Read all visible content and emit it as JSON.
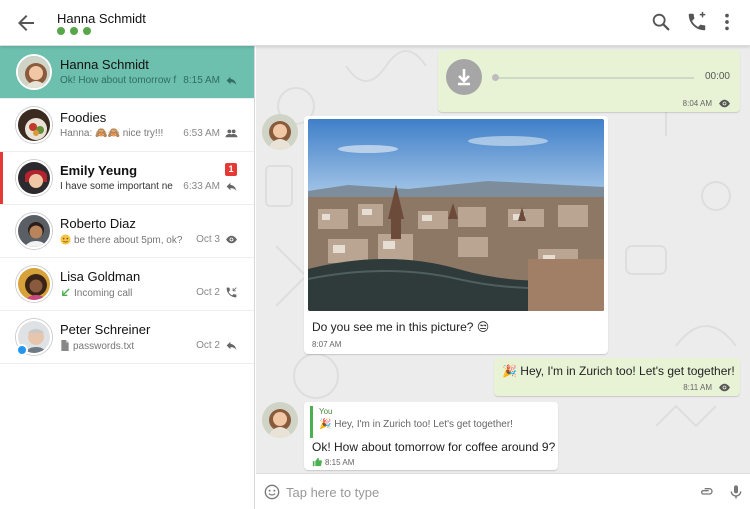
{
  "header": {
    "title": "Hanna Schmidt",
    "status_dots": 3,
    "icons": [
      "back-arrow-icon",
      "search-icon",
      "phone-icon",
      "more-vert-icon"
    ]
  },
  "conversations": [
    {
      "name": "Hanna Schmidt",
      "preview": "Ok! How about tomorrow f",
      "time": "8:15 AM",
      "status_icon": "reply-icon",
      "active": true
    },
    {
      "name": "Foodies",
      "preview": "Hanna: 🙈🙈 nice try!!!",
      "time": "6:53 AM",
      "status_icon": "group-icon"
    },
    {
      "name": "Emily Yeung",
      "preview": "I have some important ne",
      "time": "6:33 AM",
      "status_icon": "reply-icon",
      "unread_count": "1",
      "unread": true
    },
    {
      "name": "Roberto Diaz",
      "preview": "be there about 5pm, ok?",
      "time": "Oct 3",
      "status_icon": "eye-icon"
    },
    {
      "name": "Lisa Goldman",
      "preview": "Incoming call",
      "time": "Oct 2",
      "status_icon": "call-icon"
    },
    {
      "name": "Peter Schreiner",
      "preview": "passwords.txt",
      "time": "Oct 2",
      "status_icon": "reply-icon"
    }
  ],
  "messages": {
    "audio": {
      "duration": "00:00",
      "time": "8:04 AM"
    },
    "photo": {
      "caption": "Do you see me in this picture? 😒",
      "time": "8:07 AM"
    },
    "outgoing": {
      "text": "🎉 Hey, I'm in Zurich too!  Let's get together!",
      "time": "8:11 AM"
    },
    "reply": {
      "quote_author": "You",
      "quote_text": "🎉 Hey, I'm in Zurich too!  Let's get together!",
      "text": "Ok! How about tomorrow for coffee around 9?",
      "time": "8:15 AM"
    }
  },
  "composer": {
    "placeholder": "Tap here to type"
  },
  "colors": {
    "active_conversation": "#6dbfae",
    "online_dot": "#57a64a",
    "unread": "#e53935",
    "outgoing_bubble": "#e8f3d6",
    "quote_bar": "#4caf50"
  }
}
